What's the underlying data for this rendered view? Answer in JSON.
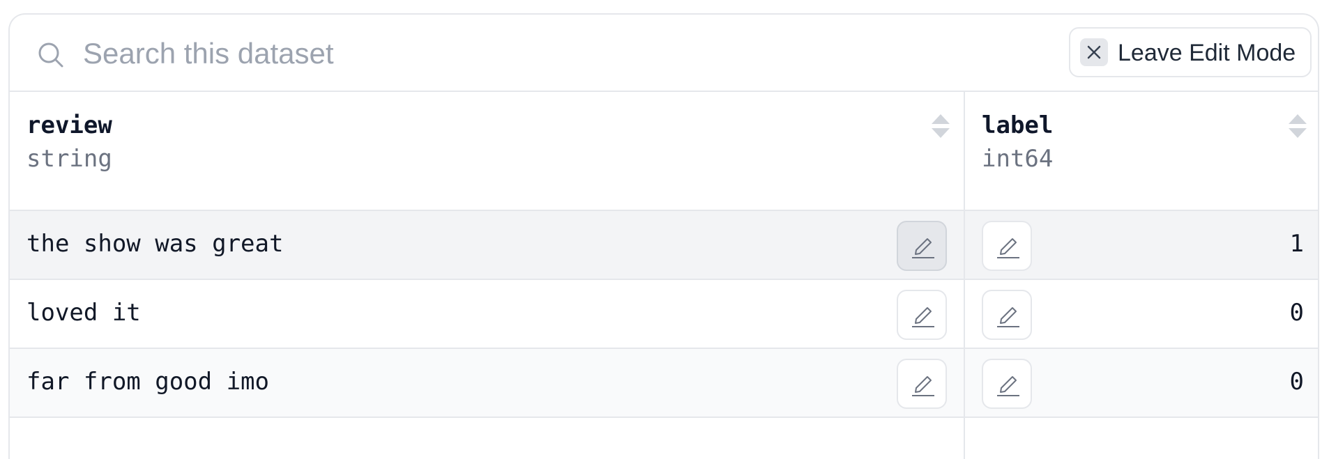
{
  "search": {
    "placeholder": "Search this dataset",
    "value": ""
  },
  "toolbar": {
    "leave_edit_label": "Leave Edit Mode",
    "close_icon": "close-icon"
  },
  "columns": [
    {
      "name": "review",
      "type": "string",
      "sort_icon": "sort-icon"
    },
    {
      "name": "label",
      "type": "int64",
      "sort_icon": "sort-icon"
    }
  ],
  "rows": [
    {
      "review": "the show was great",
      "label": "1"
    },
    {
      "review": "loved it",
      "label": "0"
    },
    {
      "review": "far from good imo",
      "label": "0"
    }
  ],
  "icons": {
    "search": "search-icon",
    "edit": "pencil-icon"
  },
  "colors": {
    "border": "#e5e7eb",
    "placeholder": "#9ca3af",
    "muted_text": "#6b7280",
    "hover_row": "#f3f4f6"
  }
}
